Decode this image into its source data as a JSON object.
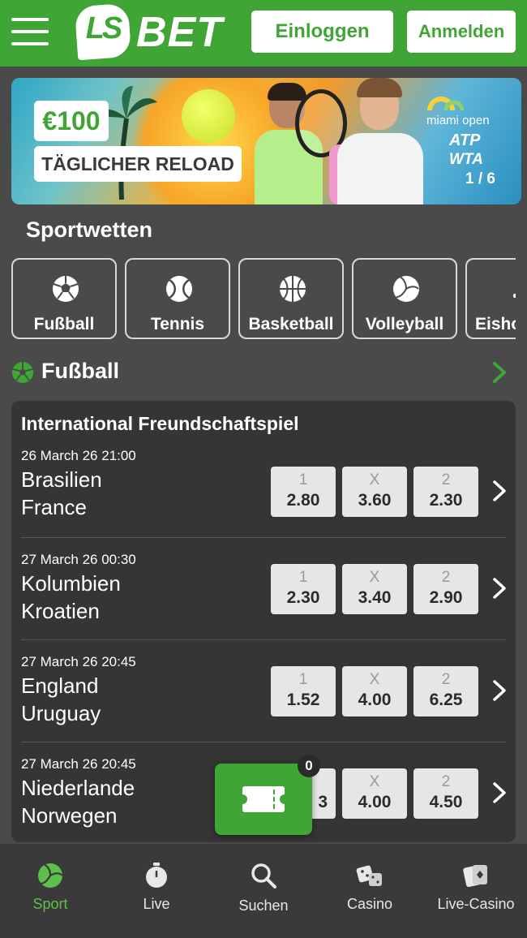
{
  "header": {
    "logo_badge": "LS",
    "logo_text": "BET",
    "login_label": "Einloggen",
    "register_label": "Anmelden",
    "brand_color": "#3fa535"
  },
  "banner": {
    "amount": "€100",
    "promo": "TÄGLICHER RELOAD",
    "event": "miami open",
    "tour1": "ATP",
    "tour2": "WTA",
    "counter": "1 / 6"
  },
  "sports": {
    "title": "Sportwetten",
    "items": [
      {
        "label": "Fußball",
        "icon": "soccer-ball-icon"
      },
      {
        "label": "Tennis",
        "icon": "tennis-ball-icon"
      },
      {
        "label": "Basketball",
        "icon": "basketball-icon"
      },
      {
        "label": "Volleyball",
        "icon": "volleyball-icon"
      },
      {
        "label": "Eisho",
        "icon": "ice-hockey-icon"
      }
    ]
  },
  "section": {
    "title": "Fußball"
  },
  "competition": {
    "title": "International Freundschaftspiel",
    "matches": [
      {
        "time": "26 March 26 21:00",
        "home": "Brasilien",
        "away": "France",
        "odds": [
          {
            "label": "1",
            "value": "2.80"
          },
          {
            "label": "X",
            "value": "3.60"
          },
          {
            "label": "2",
            "value": "2.30"
          }
        ]
      },
      {
        "time": "27 March 26 00:30",
        "home": "Kolumbien",
        "away": "Kroatien",
        "odds": [
          {
            "label": "1",
            "value": "2.30"
          },
          {
            "label": "X",
            "value": "3.40"
          },
          {
            "label": "2",
            "value": "2.90"
          }
        ]
      },
      {
        "time": "27 March 26 20:45",
        "home": "England",
        "away": "Uruguay",
        "odds": [
          {
            "label": "1",
            "value": "1.52"
          },
          {
            "label": "X",
            "value": "4.00"
          },
          {
            "label": "2",
            "value": "6.25"
          }
        ]
      },
      {
        "time": "27 March 26 20:45",
        "home": "Niederlande",
        "away": "Norwegen",
        "odds": [
          {
            "label": "1",
            "value": "3"
          },
          {
            "label": "X",
            "value": "4.00"
          },
          {
            "label": "2",
            "value": "4.50"
          }
        ]
      }
    ]
  },
  "betslip": {
    "count": "0"
  },
  "nav": {
    "items": [
      {
        "label": "Sport",
        "icon": "sport-ball-icon",
        "active": true
      },
      {
        "label": "Live",
        "icon": "stopwatch-icon"
      },
      {
        "label": "Suchen",
        "icon": "search-icon"
      },
      {
        "label": "Casino",
        "icon": "dice-icon"
      },
      {
        "label": "Live-Casino",
        "icon": "cards-icon"
      }
    ]
  }
}
